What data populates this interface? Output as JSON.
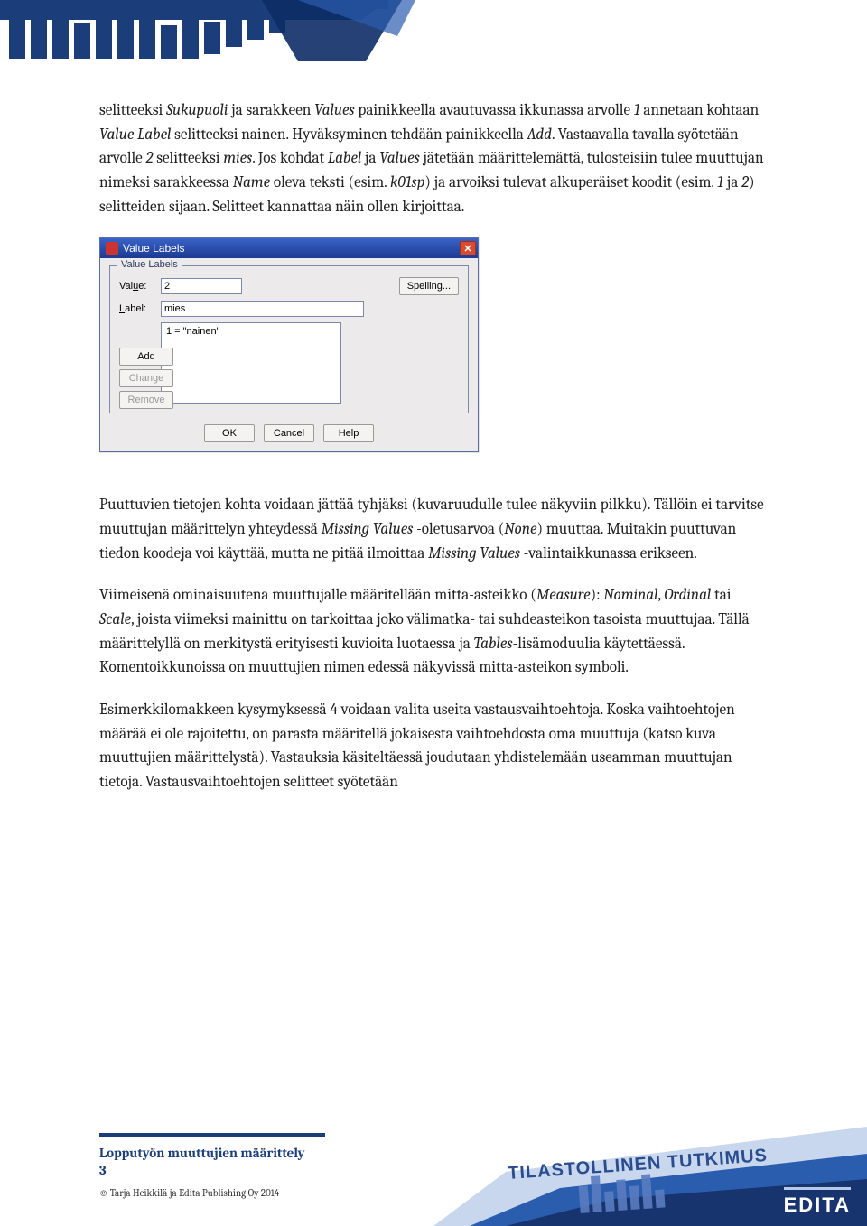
{
  "top_decoration_color": "#1b3e7a",
  "para1_parts": [
    {
      "t": "selitteeksi ",
      "i": false
    },
    {
      "t": "Sukupuoli",
      "i": true
    },
    {
      "t": " ja sarakkeen ",
      "i": false
    },
    {
      "t": "Values",
      "i": true
    },
    {
      "t": " painikkeella avautuvassa ikkunassa arvolle ",
      "i": false
    },
    {
      "t": "1",
      "i": true
    },
    {
      "t": " annetaan kohtaan ",
      "i": false
    },
    {
      "t": "Value Label",
      "i": true
    },
    {
      "t": " selitteeksi nainen. Hyväksyminen tehdään painikkeella ",
      "i": false
    },
    {
      "t": "Add",
      "i": true
    },
    {
      "t": ". Vastaavalla tavalla syötetään arvolle ",
      "i": false
    },
    {
      "t": "2",
      "i": true
    },
    {
      "t": " selitteeksi ",
      "i": false
    },
    {
      "t": "mies",
      "i": true
    },
    {
      "t": ". Jos kohdat ",
      "i": false
    },
    {
      "t": "Label",
      "i": true
    },
    {
      "t": " ja ",
      "i": false
    },
    {
      "t": "Values",
      "i": true
    },
    {
      "t": " jätetään määrittelemättä, tulosteisiin tulee muuttujan nimeksi sarakkeessa ",
      "i": false
    },
    {
      "t": "Name",
      "i": true
    },
    {
      "t": " oleva teksti (esim. ",
      "i": false
    },
    {
      "t": "k01sp",
      "i": true
    },
    {
      "t": ") ja arvoiksi tulevat alkuperäiset koodit (esim. ",
      "i": false
    },
    {
      "t": "1",
      "i": true
    },
    {
      "t": " ja ",
      "i": false
    },
    {
      "t": "2",
      "i": true
    },
    {
      "t": ") selitteiden sijaan. Selitteet kannattaa näin ollen kirjoittaa.",
      "i": false
    }
  ],
  "dialog": {
    "title": "Value Labels",
    "legend": "Value Labels",
    "value_label_u": "u",
    "value_label_rest": "e:",
    "value_label_pre": "Val",
    "label_label_u": "L",
    "label_label_rest": "abel:",
    "value_input": "2",
    "label_input": "mies",
    "spelling": "Spelling...",
    "list_item": "1 = \"nainen\"",
    "btn_add_u": "A",
    "btn_add_rest": "dd",
    "btn_change_u": "C",
    "btn_change_rest": "hange",
    "btn_remove_u": "R",
    "btn_remove_rest": "emove",
    "btn_ok": "OK",
    "btn_cancel": "Cancel",
    "btn_help": "Help",
    "close_x": "✕"
  },
  "para2_parts": [
    {
      "t": "Puuttuvien tietojen kohta voidaan jättää tyhjäksi (kuvaruudulle tulee näkyviin pilkku). Tällöin ei tarvitse muuttujan määrittelyn yhteydessä ",
      "i": false
    },
    {
      "t": "Missing Values",
      "i": true
    },
    {
      "t": " -oletusarvoa (",
      "i": false
    },
    {
      "t": "None",
      "i": true
    },
    {
      "t": ") muuttaa. Muitakin puuttuvan tiedon koodeja voi käyttää, mutta ne pitää ilmoittaa ",
      "i": false
    },
    {
      "t": "Missing Values",
      "i": true
    },
    {
      "t": " -valintaikkunassa erikseen.",
      "i": false
    }
  ],
  "para3_parts": [
    {
      "t": "Viimeisenä ominaisuutena muuttujalle määritellään mitta-asteikko (",
      "i": false
    },
    {
      "t": "Measure",
      "i": true
    },
    {
      "t": "): ",
      "i": false
    },
    {
      "t": "Nominal",
      "i": true
    },
    {
      "t": ", ",
      "i": false
    },
    {
      "t": "Ordinal",
      "i": true
    },
    {
      "t": " tai ",
      "i": false
    },
    {
      "t": "Scale",
      "i": true
    },
    {
      "t": ", joista viimeksi mainittu on tarkoittaa joko välimatka- tai suhdeasteikon tasoista muuttujaa. Tällä määrittelyllä on merkitystä erityisesti kuvioita luotaessa ja ",
      "i": false
    },
    {
      "t": "Tables",
      "i": true
    },
    {
      "t": "-lisämoduulia käytettäessä.  Komentoikkunoissa on muuttujien nimen edessä näkyvissä mitta-asteikon symboli.",
      "i": false
    }
  ],
  "para4": "Esimerkkilomakkeen kysymyksessä 4 voidaan valita useita vastausvaihtoehtoja. Koska vaihtoehtojen määrää ei ole rajoitettu, on parasta määritellä jokaisesta vaihtoehdosta oma muuttuja (katso kuva muuttujien määrittelystä). Vastauksia käsiteltäessä joudutaan yhdistelemään useamman muuttujan tietoja. Vastausvaihtoehtojen selitteet syötetään",
  "footer": {
    "title": "Lopputyön muuttujien määrittely",
    "page": "3",
    "copyright": "© Tarja Heikkilä ja Edita Publishing Oy 2014"
  },
  "brand1": "TILASTOLLINEN TUTKIMUS",
  "brand2": "EDITA"
}
